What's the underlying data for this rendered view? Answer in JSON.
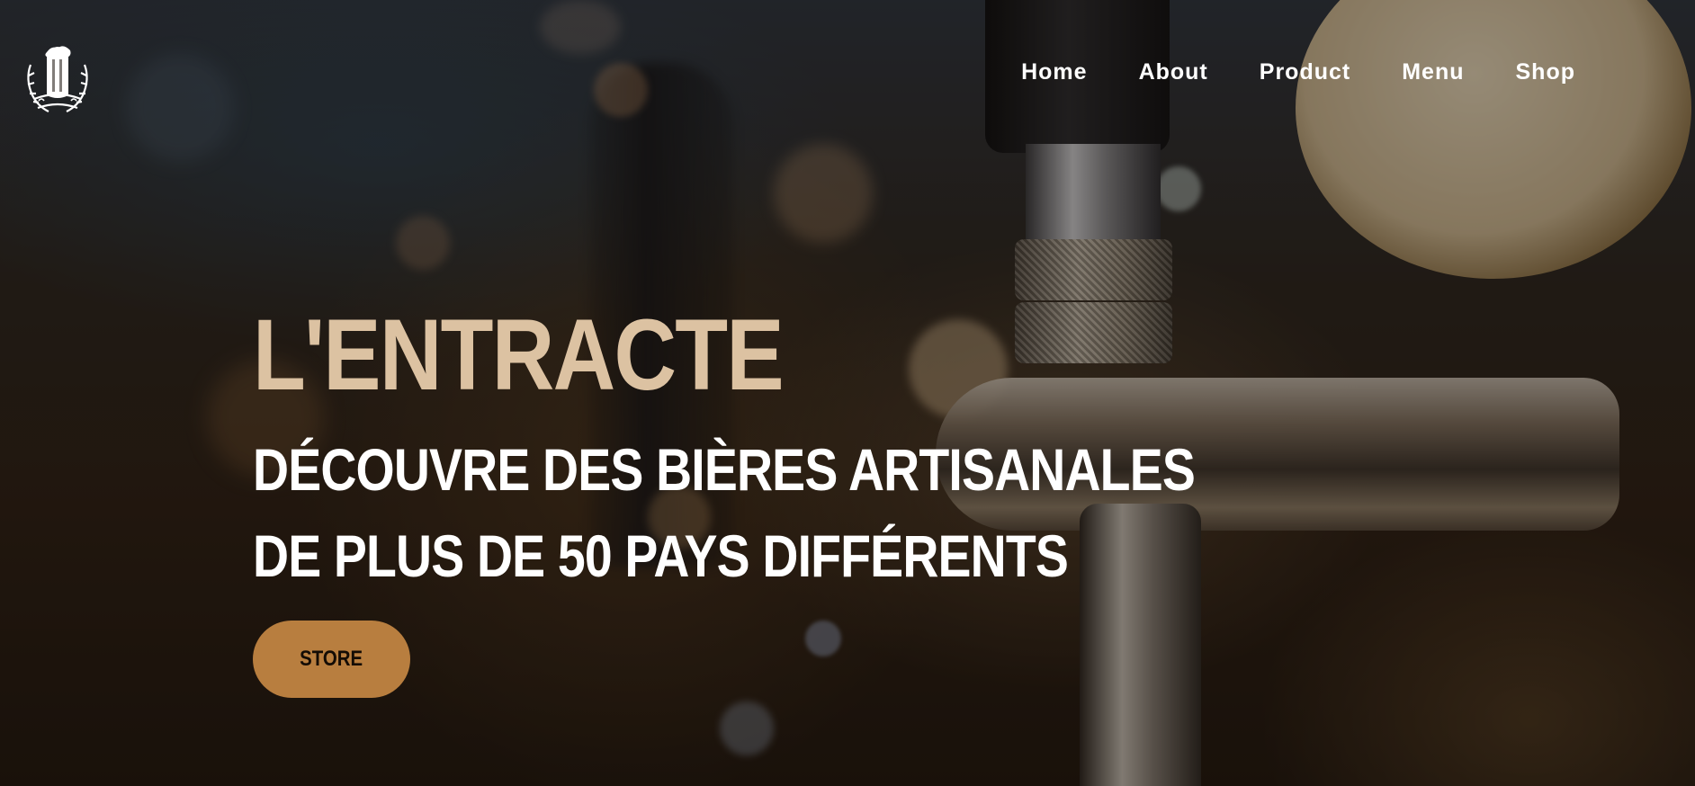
{
  "header": {
    "logo_icon": "beer-club-logo",
    "nav": [
      {
        "label": "Home"
      },
      {
        "label": "About"
      },
      {
        "label": "Product"
      },
      {
        "label": "Menu"
      },
      {
        "label": "Shop"
      }
    ]
  },
  "hero": {
    "title": "L'ENTRACTE",
    "subtitle_line1": "DÉCOUVRE DES BIÈRES ARTISANALES",
    "subtitle_line2": "DE PLUS DE 50 PAYS DIFFÉRENTS",
    "cta_label": "STORE"
  },
  "colors": {
    "title": "#dcc2a2",
    "button_bg": "#b87e3f",
    "nav_text": "#ffffff"
  }
}
